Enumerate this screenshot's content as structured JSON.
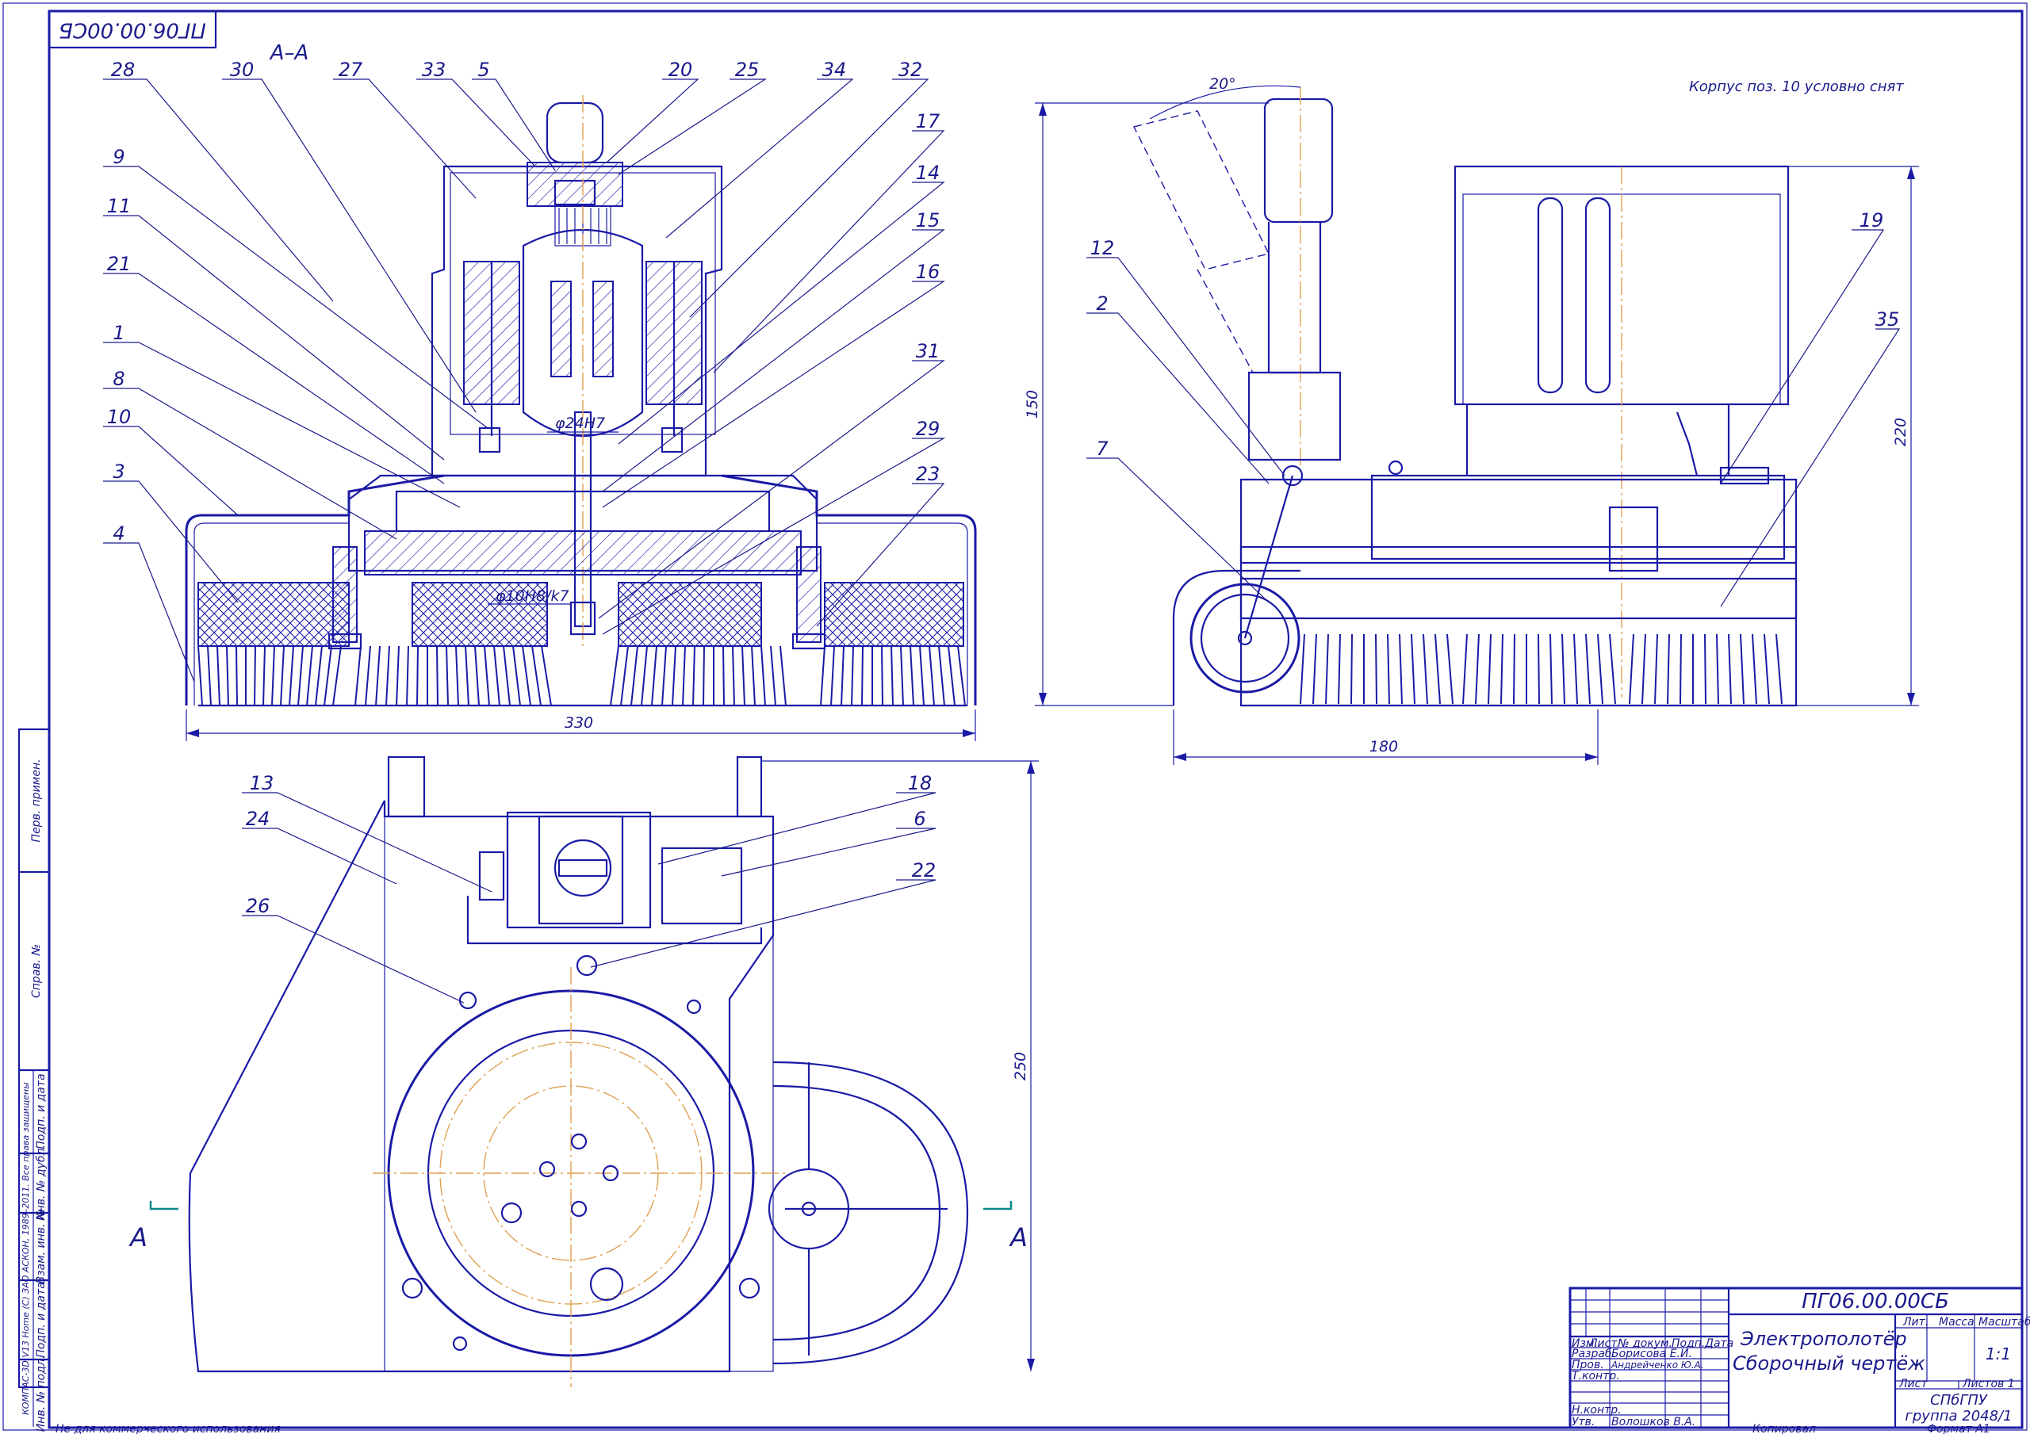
{
  "drawing": {
    "code_top": "ПГ06.00.00СБ",
    "section_label": "А–А",
    "note": "Корпус поз. 10 условно снят",
    "section_mark": "А"
  },
  "dimensions": {
    "fit_shaft": "φ24H7",
    "fit_bearing": "φ10H8/k7",
    "width_330": "330",
    "height_150": "150",
    "width_180": "180",
    "height_220": "220",
    "height_250": "250",
    "angle_20": "20°"
  },
  "positions_section": [
    "28",
    "30",
    "27",
    "33",
    "5",
    "20",
    "25",
    "34",
    "32",
    "17",
    "9",
    "11",
    "21",
    "1",
    "8",
    "10",
    "3",
    "4",
    "14",
    "15",
    "16",
    "31",
    "29",
    "23"
  ],
  "positions_side": [
    "12",
    "2",
    "7",
    "19",
    "35"
  ],
  "positions_plan": [
    "13",
    "24",
    "26",
    "18",
    "6",
    "22"
  ],
  "side_stamp": {
    "cells": [
      "Перв. примен.",
      "Справ. №",
      "Подп. и дата",
      "Инв. № дубл.",
      "Взам. инв. №",
      "Подп. и дата",
      "Инв. № подл."
    ],
    "vertical_note": "КОМПАС-3D V13 Home (С) ЗАО АСКОН, 1989–2011. Все права защищены"
  },
  "footer": {
    "left": "Не для коммерческого использования",
    "copied": "Копировал",
    "format": "Формат   А1"
  },
  "title_block": {
    "code": "ПГ06.00.00СБ",
    "name_line1": "Электрополотёр",
    "name_line2": "Сборочный чертёж",
    "col_heads": [
      "Изм.",
      "Лист",
      "№ докум.",
      "Подп.",
      "Дата"
    ],
    "roles": [
      "Разраб.",
      "Пров.",
      "Т.контр.",
      "",
      "Н.контр.",
      "Утв."
    ],
    "names": [
      "Борисова Е.И.",
      "Андрейченко Ю.А.",
      "",
      "",
      "",
      "Волошков В.А."
    ],
    "lit_head": "Лит.",
    "mass_head": "Масса",
    "scale_head": "Масштаб",
    "scale_value": "1:1",
    "sheet_label": "Лист",
    "sheets_label": "Листов   1",
    "org_line1": "СПбГПУ",
    "org_line2": "группа 2048/1"
  }
}
